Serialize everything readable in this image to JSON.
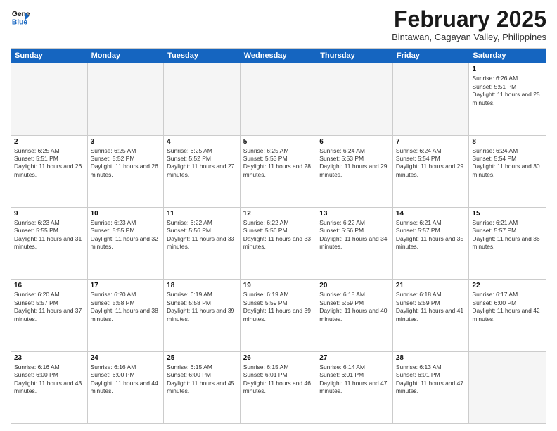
{
  "header": {
    "logo_line1": "General",
    "logo_line2": "Blue",
    "month_title": "February 2025",
    "location": "Bintawan, Cagayan Valley, Philippines"
  },
  "day_headers": [
    "Sunday",
    "Monday",
    "Tuesday",
    "Wednesday",
    "Thursday",
    "Friday",
    "Saturday"
  ],
  "weeks": [
    [
      {
        "num": "",
        "info": "",
        "empty": true
      },
      {
        "num": "",
        "info": "",
        "empty": true
      },
      {
        "num": "",
        "info": "",
        "empty": true
      },
      {
        "num": "",
        "info": "",
        "empty": true
      },
      {
        "num": "",
        "info": "",
        "empty": true
      },
      {
        "num": "",
        "info": "",
        "empty": true
      },
      {
        "num": "1",
        "info": "Sunrise: 6:26 AM\nSunset: 5:51 PM\nDaylight: 11 hours and 25 minutes.",
        "empty": false
      }
    ],
    [
      {
        "num": "2",
        "info": "Sunrise: 6:25 AM\nSunset: 5:51 PM\nDaylight: 11 hours and 26 minutes.",
        "empty": false
      },
      {
        "num": "3",
        "info": "Sunrise: 6:25 AM\nSunset: 5:52 PM\nDaylight: 11 hours and 26 minutes.",
        "empty": false
      },
      {
        "num": "4",
        "info": "Sunrise: 6:25 AM\nSunset: 5:52 PM\nDaylight: 11 hours and 27 minutes.",
        "empty": false
      },
      {
        "num": "5",
        "info": "Sunrise: 6:25 AM\nSunset: 5:53 PM\nDaylight: 11 hours and 28 minutes.",
        "empty": false
      },
      {
        "num": "6",
        "info": "Sunrise: 6:24 AM\nSunset: 5:53 PM\nDaylight: 11 hours and 29 minutes.",
        "empty": false
      },
      {
        "num": "7",
        "info": "Sunrise: 6:24 AM\nSunset: 5:54 PM\nDaylight: 11 hours and 29 minutes.",
        "empty": false
      },
      {
        "num": "8",
        "info": "Sunrise: 6:24 AM\nSunset: 5:54 PM\nDaylight: 11 hours and 30 minutes.",
        "empty": false
      }
    ],
    [
      {
        "num": "9",
        "info": "Sunrise: 6:23 AM\nSunset: 5:55 PM\nDaylight: 11 hours and 31 minutes.",
        "empty": false
      },
      {
        "num": "10",
        "info": "Sunrise: 6:23 AM\nSunset: 5:55 PM\nDaylight: 11 hours and 32 minutes.",
        "empty": false
      },
      {
        "num": "11",
        "info": "Sunrise: 6:22 AM\nSunset: 5:56 PM\nDaylight: 11 hours and 33 minutes.",
        "empty": false
      },
      {
        "num": "12",
        "info": "Sunrise: 6:22 AM\nSunset: 5:56 PM\nDaylight: 11 hours and 33 minutes.",
        "empty": false
      },
      {
        "num": "13",
        "info": "Sunrise: 6:22 AM\nSunset: 5:56 PM\nDaylight: 11 hours and 34 minutes.",
        "empty": false
      },
      {
        "num": "14",
        "info": "Sunrise: 6:21 AM\nSunset: 5:57 PM\nDaylight: 11 hours and 35 minutes.",
        "empty": false
      },
      {
        "num": "15",
        "info": "Sunrise: 6:21 AM\nSunset: 5:57 PM\nDaylight: 11 hours and 36 minutes.",
        "empty": false
      }
    ],
    [
      {
        "num": "16",
        "info": "Sunrise: 6:20 AM\nSunset: 5:57 PM\nDaylight: 11 hours and 37 minutes.",
        "empty": false
      },
      {
        "num": "17",
        "info": "Sunrise: 6:20 AM\nSunset: 5:58 PM\nDaylight: 11 hours and 38 minutes.",
        "empty": false
      },
      {
        "num": "18",
        "info": "Sunrise: 6:19 AM\nSunset: 5:58 PM\nDaylight: 11 hours and 39 minutes.",
        "empty": false
      },
      {
        "num": "19",
        "info": "Sunrise: 6:19 AM\nSunset: 5:59 PM\nDaylight: 11 hours and 39 minutes.",
        "empty": false
      },
      {
        "num": "20",
        "info": "Sunrise: 6:18 AM\nSunset: 5:59 PM\nDaylight: 11 hours and 40 minutes.",
        "empty": false
      },
      {
        "num": "21",
        "info": "Sunrise: 6:18 AM\nSunset: 5:59 PM\nDaylight: 11 hours and 41 minutes.",
        "empty": false
      },
      {
        "num": "22",
        "info": "Sunrise: 6:17 AM\nSunset: 6:00 PM\nDaylight: 11 hours and 42 minutes.",
        "empty": false
      }
    ],
    [
      {
        "num": "23",
        "info": "Sunrise: 6:16 AM\nSunset: 6:00 PM\nDaylight: 11 hours and 43 minutes.",
        "empty": false
      },
      {
        "num": "24",
        "info": "Sunrise: 6:16 AM\nSunset: 6:00 PM\nDaylight: 11 hours and 44 minutes.",
        "empty": false
      },
      {
        "num": "25",
        "info": "Sunrise: 6:15 AM\nSunset: 6:00 PM\nDaylight: 11 hours and 45 minutes.",
        "empty": false
      },
      {
        "num": "26",
        "info": "Sunrise: 6:15 AM\nSunset: 6:01 PM\nDaylight: 11 hours and 46 minutes.",
        "empty": false
      },
      {
        "num": "27",
        "info": "Sunrise: 6:14 AM\nSunset: 6:01 PM\nDaylight: 11 hours and 47 minutes.",
        "empty": false
      },
      {
        "num": "28",
        "info": "Sunrise: 6:13 AM\nSunset: 6:01 PM\nDaylight: 11 hours and 47 minutes.",
        "empty": false
      },
      {
        "num": "",
        "info": "",
        "empty": true
      }
    ]
  ]
}
